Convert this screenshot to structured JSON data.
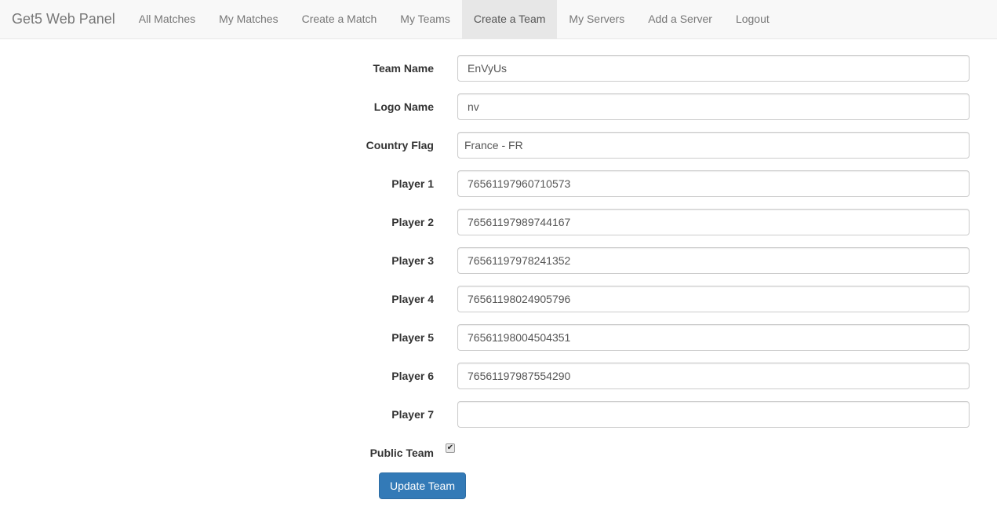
{
  "nav": {
    "brand": "Get5 Web Panel",
    "items": [
      "All Matches",
      "My Matches",
      "Create a Match",
      "My Teams",
      "Create a Team",
      "My Servers",
      "Add a Server",
      "Logout"
    ],
    "active": "Create a Team"
  },
  "form": {
    "fields": [
      {
        "label": "Team Name",
        "value": "EnVyUs"
      },
      {
        "label": "Logo Name",
        "value": "nv"
      },
      {
        "label": "Country Flag",
        "value": "France - FR"
      },
      {
        "label": "Player 1",
        "value": "76561197960710573"
      },
      {
        "label": "Player 2",
        "value": "76561197989744167"
      },
      {
        "label": "Player 3",
        "value": "76561197978241352"
      },
      {
        "label": "Player 4",
        "value": "76561198024905796"
      },
      {
        "label": "Player 5",
        "value": "76561198004504351"
      },
      {
        "label": "Player 6",
        "value": "76561197987554290"
      },
      {
        "label": "Player 7",
        "value": ""
      }
    ],
    "public_label": "Public Team",
    "public_checked": true,
    "submit": "Update Team"
  }
}
